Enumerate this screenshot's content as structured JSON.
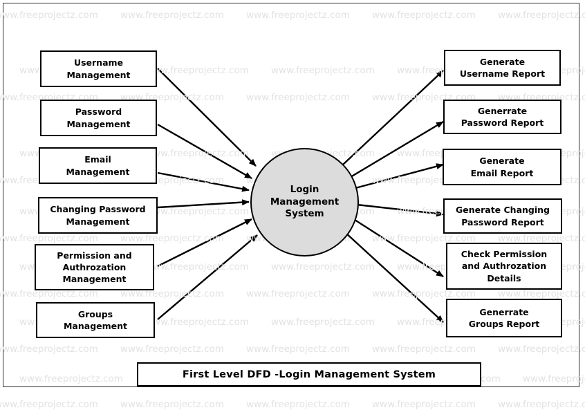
{
  "diagram": {
    "title": "First Level DFD -Login Management System",
    "process": {
      "label": "Login\nManagement\nSystem",
      "shape": "circle",
      "fill_color": "#dcdcdc",
      "stroke_color": "#000000"
    },
    "inputs": [
      {
        "label": "Username\nManagement"
      },
      {
        "label": "Password\nManagement"
      },
      {
        "label": "Email\nManagement"
      },
      {
        "label": "Changing Password\nManagement"
      },
      {
        "label": "Permission and\nAuthrozation\nManagement"
      },
      {
        "label": "Groups\nManagement"
      }
    ],
    "outputs": [
      {
        "label": "Generate\nUsername Report"
      },
      {
        "label": "Generrate\nPassword Report"
      },
      {
        "label": "Generate\nEmail Report"
      },
      {
        "label": "Generate Changing\nPassword Report"
      },
      {
        "label": "Check Permission\nand Authrozation\nDetails"
      },
      {
        "label": "Generrate\nGroups Report"
      }
    ]
  },
  "watermark": {
    "text": "www.freeprojectz.com",
    "color": "#e2e2e2"
  }
}
